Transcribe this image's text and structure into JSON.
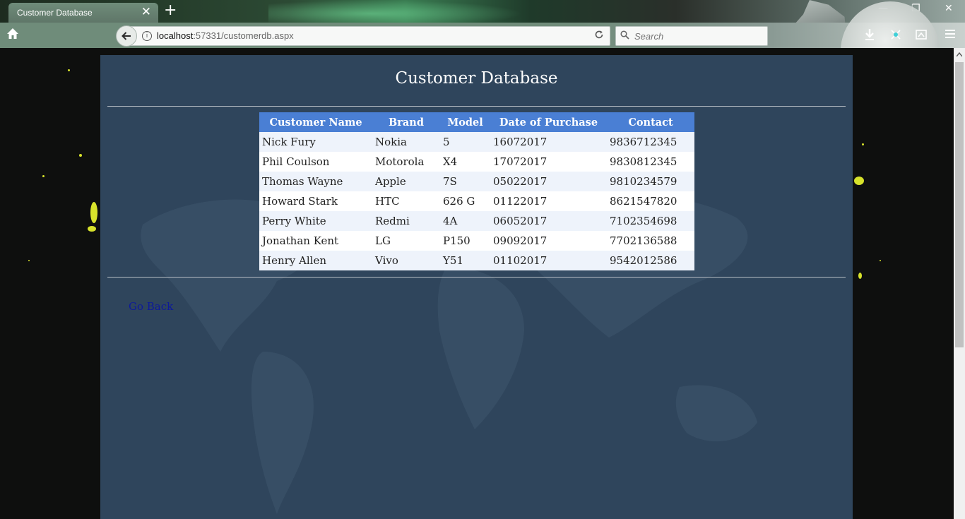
{
  "browser": {
    "tab_title": "Customer Database",
    "tab_close": "✕",
    "new_tab": "+",
    "url_host": "localhost",
    "url_rest": ":57331/customerdb.aspx",
    "search_placeholder": "Search",
    "window_controls": {
      "minimize": "—",
      "restore": "❐",
      "close": "✕"
    }
  },
  "page": {
    "title": "Customer Database",
    "table": {
      "headers": [
        "Customer Name",
        "Brand",
        "Model",
        "Date of Purchase",
        "Contact"
      ],
      "rows": [
        [
          "Nick Fury",
          "Nokia",
          "5",
          "16072017",
          "9836712345"
        ],
        [
          "Phil Coulson",
          "Motorola",
          "X4",
          "17072017",
          "9830812345"
        ],
        [
          "Thomas Wayne",
          "Apple",
          "7S",
          "05022017",
          "9810234579"
        ],
        [
          "Howard Stark",
          "HTC",
          "626 G",
          "01122017",
          "8621547820"
        ],
        [
          "Perry White",
          "Redmi",
          "4A",
          "06052017",
          "7102354698"
        ],
        [
          "Jonathan Kent",
          "LG",
          "P150",
          "09092017",
          "7702136588"
        ],
        [
          "Henry Allen",
          "Vivo",
          "Y51",
          "01102017",
          "9542012586"
        ]
      ]
    },
    "go_back": "Go Back"
  },
  "colors": {
    "content_bg": "#2f455c",
    "header_bg": "#4a7fd4",
    "link": "#0d1a9a"
  }
}
